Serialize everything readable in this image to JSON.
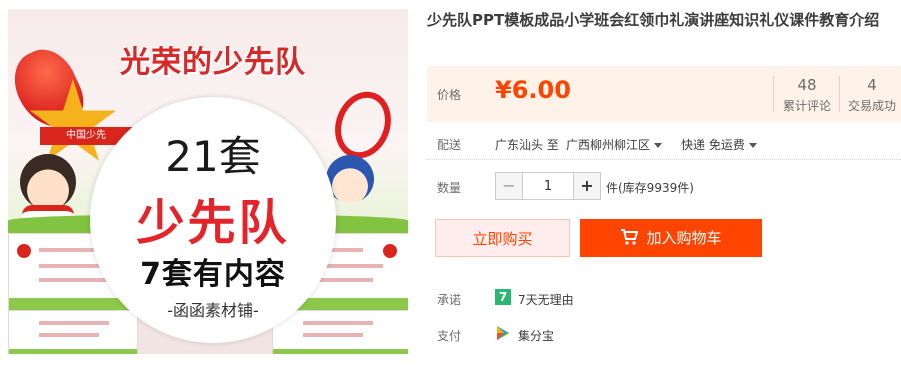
{
  "image": {
    "banner_title": "光荣的少先队",
    "ribbon_text": "中国少先",
    "badge_line1": "21套",
    "badge_line2": "少先队",
    "badge_line3": "7套有内容",
    "badge_line4": "-函函素材铺-"
  },
  "product": {
    "title": "少先队PPT模板成品小学班会红领巾礼演讲座知识礼仪课件教育介绍"
  },
  "price": {
    "label": "价格",
    "value": "¥6.00",
    "reviews_count": "48",
    "reviews_label": "累计评论",
    "sales_count": "4",
    "sales_label": "交易成功"
  },
  "delivery": {
    "label": "配送",
    "from": "广东汕头 至",
    "to": "广西柳州柳江区",
    "shipping": "快递 免运费"
  },
  "quantity": {
    "label": "数量",
    "minus": "−",
    "value": "1",
    "plus": "+",
    "stock": "件(库存9939件)"
  },
  "buttons": {
    "buy_now": "立即购买",
    "add_to_cart": "加入购物车"
  },
  "promise": {
    "label": "承诺",
    "icon_text": "7",
    "text": "7天无理由"
  },
  "payment": {
    "label": "支付",
    "text": "集分宝"
  },
  "colors": {
    "accent": "#ff4400",
    "price_bg": "#fff2e8"
  }
}
